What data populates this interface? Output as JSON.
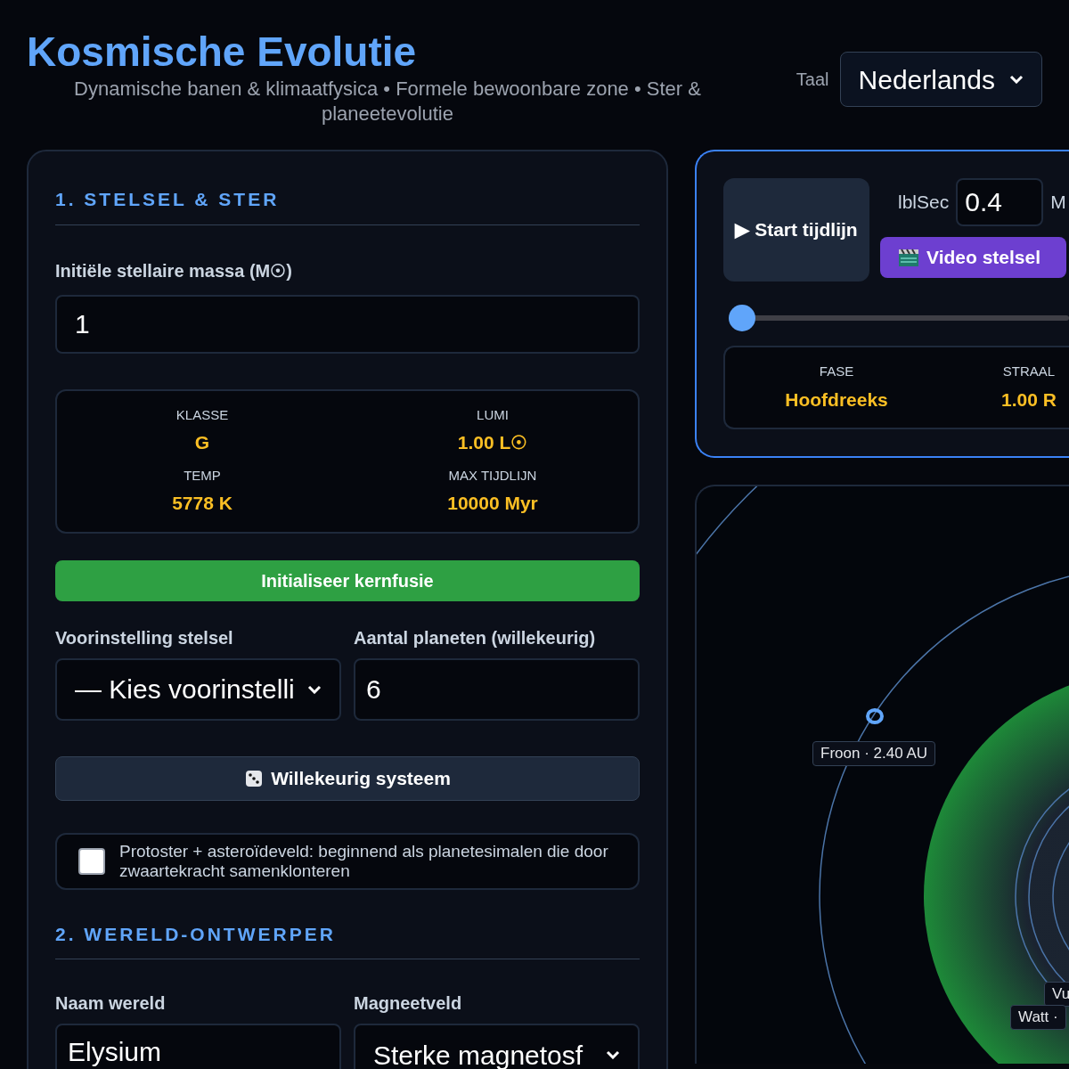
{
  "header": {
    "title": "Kosmische Evolutie",
    "subtitle": "Dynamische banen & klimaatfysica • Formele bewoonbare zone • Ster & planeetevolutie",
    "language_label": "Taal",
    "language": "Nederlands"
  },
  "section_1": {
    "heading": "1. STELSEL & STER",
    "mass_label": "Initiële stellaire massa (M☉)",
    "mass_value": "1",
    "stats": [
      {
        "label": "KLASSE",
        "value": "G"
      },
      {
        "label": "LUMI",
        "value": "1.00 L☉"
      },
      {
        "label": "TEMP",
        "value": "5778 K"
      },
      {
        "label": "MAX TIJDLIJN",
        "value": "10000 Myr"
      }
    ],
    "fusion_button": "Initialiseer kernfusie",
    "preset_label": "Voorinstelling stelsel",
    "preset_value": "— Kies voorinstelli",
    "planets_label": "Aantal planeten (willekeurig)",
    "planets_value": "6",
    "random_button": "Willekeurig systeem",
    "protostar": {
      "label": "Protoster + asteroïdeveld: beginnend als planetesimalen die door zwaartekracht samenklonteren",
      "checked": false
    }
  },
  "section_2": {
    "heading": "2. WERELD-ONTWERPER",
    "name_label": "Naam wereld",
    "name_value": "Elysium",
    "magnet_label": "Magneetveld",
    "magnet_value": "Sterke magnetosf"
  },
  "timeline": {
    "start_button": "▶ Start tijdlijn",
    "sec_label": "lblSec",
    "sec_value": "0.4",
    "cut_label": "M",
    "video_button": "Video stelsel",
    "slider": {
      "level": 0
    },
    "stats": [
      {
        "label": "FASE",
        "value": "Hoofdreeks"
      },
      {
        "label": "STRAAL",
        "value": "1.00 R"
      }
    ]
  },
  "orbit_view": {
    "labels": [
      {
        "text": "Froon · 2.40 AU"
      },
      {
        "text": "Vu"
      },
      {
        "text": "Watt ·"
      }
    ]
  }
}
